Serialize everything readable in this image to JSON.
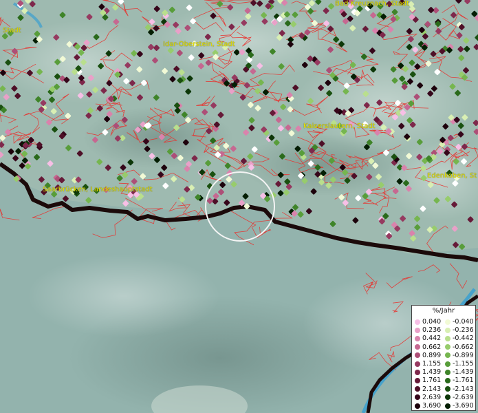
{
  "map": {
    "places": [
      {
        "id": "stadt-nw",
        "label": "Stadt"
      },
      {
        "id": "bad-kreuznach",
        "label": "Bad Kreuznach, Stadt"
      },
      {
        "id": "idar-oberstein",
        "label": "Idar-Oberstein, Stadt"
      },
      {
        "id": "kaiserslautern",
        "label": "Kaiserslautern, Stadt"
      },
      {
        "id": "saarbruecken",
        "label": "Saarbrücken, Landeshauptstadt"
      },
      {
        "id": "edenkoben",
        "label": "Edenkoben, St"
      }
    ],
    "colors": {
      "boundary_lines": "#e8322e",
      "border": "#1b0a0a",
      "terrain": "#93b3ad",
      "label": "#e6e400",
      "cursor_circle": "#f4f4f4"
    }
  },
  "legend": {
    "title": "%/Jahr",
    "positive": [
      {
        "label": "0.040",
        "color": "#f7bfe6"
      },
      {
        "label": "0.236",
        "color": "#e9a0c8"
      },
      {
        "label": "0.442",
        "color": "#d983ac"
      },
      {
        "label": "0.662",
        "color": "#c66891"
      },
      {
        "label": "0.899",
        "color": "#ad4f77"
      },
      {
        "label": "1.155",
        "color": "#963a60"
      },
      {
        "label": "1.439",
        "color": "#7e284b"
      },
      {
        "label": "1.761",
        "color": "#661a38"
      },
      {
        "label": "2.143",
        "color": "#4e0f27"
      },
      {
        "label": "2.639",
        "color": "#36061a"
      },
      {
        "label": "3.690",
        "color": "#1d020c"
      }
    ],
    "negative": [
      {
        "label": "-0.040",
        "color": "#f2fad6"
      },
      {
        "label": "-0.236",
        "color": "#d9efb3"
      },
      {
        "label": "-0.442",
        "color": "#b9df8d"
      },
      {
        "label": "-0.662",
        "color": "#97cc6c"
      },
      {
        "label": "-0.899",
        "color": "#76b64f"
      },
      {
        "label": "-1.155",
        "color": "#589d3a"
      },
      {
        "label": "-1.439",
        "color": "#3f8429"
      },
      {
        "label": "-1.761",
        "color": "#2a6a1b"
      },
      {
        "label": "-2.143",
        "color": "#1a5010"
      },
      {
        "label": "-2.639",
        "color": "#0d3708"
      },
      {
        "label": "-3.690",
        "color": "#041e03"
      }
    ]
  }
}
